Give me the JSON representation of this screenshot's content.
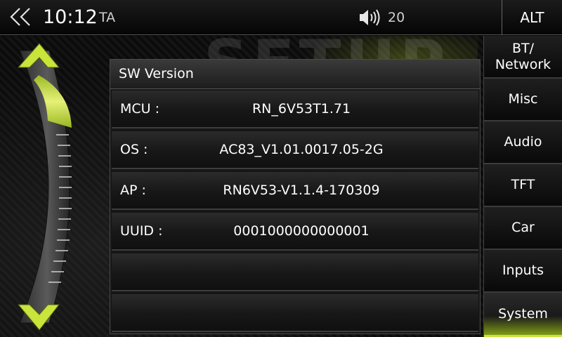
{
  "status_bar": {
    "time": "10:12",
    "ta": "TA",
    "volume": "20",
    "alt_label": "ALT"
  },
  "background_text": "SETUP",
  "panel": {
    "title": "SW Version",
    "rows": [
      {
        "label": "MCU :",
        "value": "RN_6V53T1.71"
      },
      {
        "label": "OS :",
        "value": "AC83_V1.01.0017.05-2G"
      },
      {
        "label": "AP :",
        "value": "RN6V53-V1.1.4-170309"
      },
      {
        "label": "UUID :",
        "value": "0001000000000001"
      },
      {
        "label": "",
        "value": ""
      },
      {
        "label": "",
        "value": ""
      }
    ]
  },
  "sidebar": {
    "items": [
      {
        "label": "BT/\nNetwork"
      },
      {
        "label": "Misc"
      },
      {
        "label": "Audio"
      },
      {
        "label": "TFT"
      },
      {
        "label": "Car"
      },
      {
        "label": "Inputs"
      },
      {
        "label": "System",
        "active": true
      }
    ]
  },
  "icons": {
    "back": "double-chevron-left-icon",
    "volume": "speaker-icon",
    "scroll_up": "arrow-up-icon",
    "scroll_down": "arrow-down-icon"
  },
  "colors": {
    "accent": "#c9e43a",
    "accent_dark": "#7f9a16",
    "background": "#050505"
  }
}
